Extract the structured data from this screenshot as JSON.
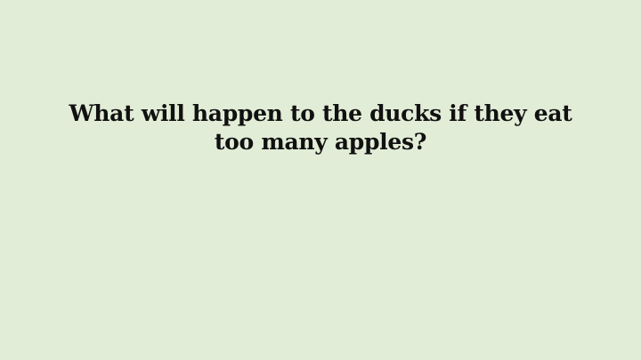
{
  "slide": {
    "background_color": "#e2edd7",
    "title": "What will happen to the ducks if they eat too many apples?"
  }
}
